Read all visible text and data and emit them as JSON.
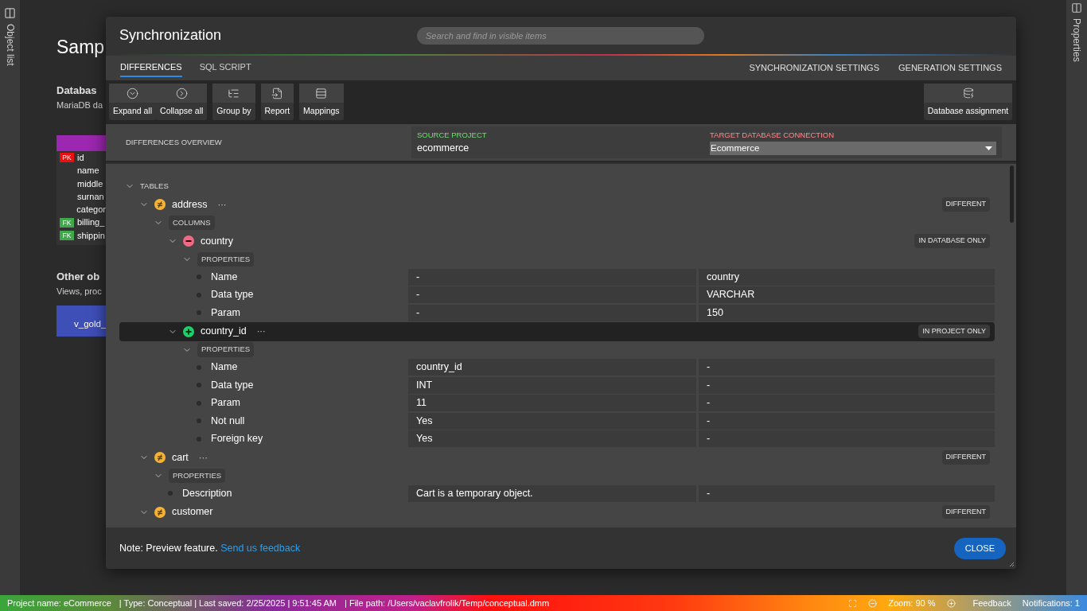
{
  "left_panel": {
    "label": "Object list"
  },
  "right_panel": {
    "label": "Properties"
  },
  "background": {
    "title": "Samp",
    "database_heading": "Databas",
    "database_text": "MariaDB da",
    "entity": {
      "color": "#9c27b0",
      "columns": [
        {
          "name": "id",
          "key": "PK",
          "color": "#e81010"
        },
        {
          "name": "name"
        },
        {
          "name": "middle"
        },
        {
          "name": "surnan"
        },
        {
          "name": "categor"
        },
        {
          "name": "billing_",
          "key": "FK",
          "color": "#40a84a"
        },
        {
          "name": "shippin",
          "key": "FK",
          "color": "#40a84a"
        }
      ]
    },
    "other_heading": "Other ob",
    "other_text": "Views, proc",
    "view": {
      "name": "v_gold_",
      "color": "#3f4fb8"
    }
  },
  "dialog": {
    "title": "Synchronization",
    "search": {
      "placeholder": "Search and find in visible items"
    },
    "tabs": [
      {
        "label": "DIFFERENCES",
        "selected": true
      },
      {
        "label": "SQL SCRIPT",
        "selected": false
      }
    ],
    "settings_buttons": [
      "SYNCHRONIZATION SETTINGS",
      "GENERATION SETTINGS"
    ],
    "toolbar_groups": [
      [
        "Expand all",
        "Collapse all"
      ],
      [
        "Group by"
      ],
      [
        "Report"
      ],
      [
        "Mappings"
      ]
    ],
    "right_button": "Database assignment",
    "overview": {
      "label": "DIFFERENCES OVERVIEW",
      "source": {
        "label": "SOURCE PROJECT",
        "value": "ecommerce"
      },
      "target": {
        "label": "TARGET DATABASE CONNECTION",
        "value": "Ecommerce"
      }
    },
    "tree": [
      {
        "kind": "section",
        "label": "TABLES",
        "expanded": true,
        "children": [
          {
            "kind": "object",
            "name": "address",
            "menu": "···",
            "badge": {
              "kind": "different",
              "label": "DIFFERENT"
            },
            "expanded": true,
            "selected": false,
            "children": [
              {
                "kind": "section",
                "label": "COLUMNS",
                "expanded": true,
                "children": [
                  {
                    "kind": "object",
                    "name": "country",
                    "badge": {
                      "kind": "database_only",
                      "label": "IN DATABASE ONLY"
                    },
                    "expanded": true,
                    "selected": false,
                    "children": [
                      {
                        "kind": "section",
                        "label": "PROPERTIES",
                        "expanded": true,
                        "children": [
                          {
                            "kind": "property",
                            "name": "Name",
                            "project": "-",
                            "database": "country"
                          },
                          {
                            "kind": "property",
                            "name": "Data type",
                            "project": "-",
                            "database": "VARCHAR"
                          },
                          {
                            "kind": "property",
                            "name": "Param",
                            "project": "-",
                            "database": "150"
                          }
                        ]
                      }
                    ]
                  },
                  {
                    "kind": "object",
                    "name": "country_id",
                    "menu": "···",
                    "badge": {
                      "kind": "project_only",
                      "label": "IN PROJECT ONLY"
                    },
                    "expanded": true,
                    "selected": true,
                    "children": [
                      {
                        "kind": "section",
                        "label": "PROPERTIES",
                        "expanded": true,
                        "children": [
                          {
                            "kind": "property",
                            "name": "Name",
                            "project": "country_id",
                            "database": "-"
                          },
                          {
                            "kind": "property",
                            "name": "Data type",
                            "project": "INT",
                            "database": "-"
                          },
                          {
                            "kind": "property",
                            "name": "Param",
                            "project": "11",
                            "database": "-"
                          },
                          {
                            "kind": "property",
                            "name": "Not null",
                            "project": "Yes",
                            "database": "-"
                          },
                          {
                            "kind": "property",
                            "name": "Foreign key",
                            "project": "Yes",
                            "database": "-"
                          }
                        ]
                      }
                    ]
                  }
                ]
              }
            ]
          },
          {
            "kind": "object",
            "name": "cart",
            "menu": "···",
            "badge": {
              "kind": "different",
              "label": "DIFFERENT"
            },
            "expanded": true,
            "selected": false,
            "children": [
              {
                "kind": "section",
                "label": "PROPERTIES",
                "expanded": true,
                "children": [
                  {
                    "kind": "property",
                    "name": "Description",
                    "project": "Cart is a temporary object.",
                    "database": "-"
                  }
                ]
              }
            ]
          },
          {
            "kind": "object",
            "name": "customer",
            "badge": {
              "kind": "different",
              "label": "DIFFERENT"
            },
            "expanded": true,
            "selected": false
          }
        ]
      }
    ],
    "footer": {
      "note": "Note: Preview feature. ",
      "link": "Send us feedback",
      "close": "CLOSE"
    }
  },
  "status_bar": {
    "left": [
      "Project name: eCommerce",
      "| Type: Conceptual | Last saved: 2/25/2025 | 9:51:45 AM",
      "| File path: /Users/vaclavfrolik/Temp/conceptual.dmm"
    ],
    "zoom": "Zoom: 90 %",
    "feedback": "Feedback",
    "notifications": "Notifications: 1"
  }
}
